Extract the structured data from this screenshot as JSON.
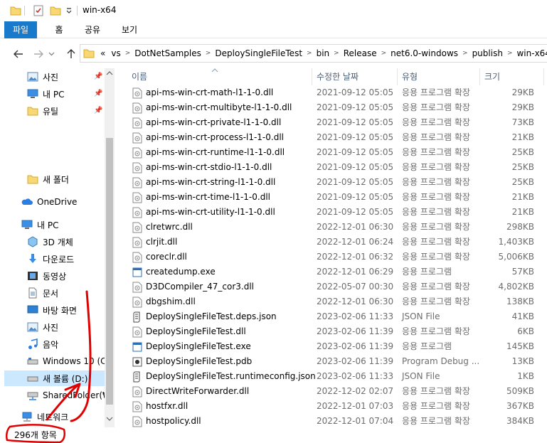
{
  "window": {
    "title": "win-x64",
    "colors": {
      "accent": "#1979ca",
      "selection": "#cce8ff",
      "annotation": "#e00000"
    }
  },
  "ribbon": {
    "tabs": [
      "파일",
      "홈",
      "공유",
      "보기"
    ]
  },
  "address": {
    "overflow": "«",
    "crumbs": [
      "vs",
      "DotNetSamples",
      "DeploySingleFileTest",
      "bin",
      "Release",
      "net6.0-windows",
      "publish",
      "win-x64"
    ]
  },
  "nav": {
    "quick": [
      {
        "label": "사진",
        "icon": "pictures-icon",
        "pinned": true
      },
      {
        "label": "내 PC",
        "icon": "pc-icon",
        "pinned": true
      },
      {
        "label": "유틸",
        "icon": "folder-icon",
        "pinned": true
      }
    ],
    "new_folder": "새 폴더",
    "onedrive": "OneDrive",
    "this_pc": "내 PC",
    "pc_items": [
      {
        "label": "3D 개체",
        "icon": "3d-objects-icon"
      },
      {
        "label": "다운로드",
        "icon": "download-icon"
      },
      {
        "label": "동영상",
        "icon": "video-icon"
      },
      {
        "label": "문서",
        "icon": "document-icon"
      },
      {
        "label": "바탕 화면",
        "icon": "desktop-icon"
      },
      {
        "label": "사진",
        "icon": "pictures-icon"
      },
      {
        "label": "음악",
        "icon": "music-icon"
      },
      {
        "label": "Windows 10 (C:",
        "icon": "drive-c-icon"
      },
      {
        "label": "새 볼륨 (D:)",
        "icon": "drive-d-icon",
        "selected": true
      },
      {
        "label": "SharedFolder(₩",
        "icon": "network-drive-icon"
      }
    ],
    "network": "네트워크"
  },
  "columns": {
    "name": "이름",
    "date": "수정한 날짜",
    "type": "유형",
    "size": "크기"
  },
  "files": [
    {
      "name": "api-ms-win-crt-math-l1-1-0.dll",
      "date": "2021-09-12 05:05",
      "type": "응용 프로그램 확장",
      "size": "29KB",
      "icon": "dll-icon"
    },
    {
      "name": "api-ms-win-crt-multibyte-l1-1-0.dll",
      "date": "2021-09-12 05:05",
      "type": "응용 프로그램 확장",
      "size": "29KB",
      "icon": "dll-icon"
    },
    {
      "name": "api-ms-win-crt-private-l1-1-0.dll",
      "date": "2021-09-12 05:05",
      "type": "응용 프로그램 확장",
      "size": "73KB",
      "icon": "dll-icon"
    },
    {
      "name": "api-ms-win-crt-process-l1-1-0.dll",
      "date": "2021-09-12 05:05",
      "type": "응용 프로그램 확장",
      "size": "21KB",
      "icon": "dll-icon"
    },
    {
      "name": "api-ms-win-crt-runtime-l1-1-0.dll",
      "date": "2021-09-12 05:05",
      "type": "응용 프로그램 확장",
      "size": "25KB",
      "icon": "dll-icon"
    },
    {
      "name": "api-ms-win-crt-stdio-l1-1-0.dll",
      "date": "2021-09-12 05:05",
      "type": "응용 프로그램 확장",
      "size": "25KB",
      "icon": "dll-icon"
    },
    {
      "name": "api-ms-win-crt-string-l1-1-0.dll",
      "date": "2021-09-12 05:05",
      "type": "응용 프로그램 확장",
      "size": "25KB",
      "icon": "dll-icon"
    },
    {
      "name": "api-ms-win-crt-time-l1-1-0.dll",
      "date": "2021-09-12 05:05",
      "type": "응용 프로그램 확장",
      "size": "21KB",
      "icon": "dll-icon"
    },
    {
      "name": "api-ms-win-crt-utility-l1-1-0.dll",
      "date": "2021-09-12 05:05",
      "type": "응용 프로그램 확장",
      "size": "21KB",
      "icon": "dll-icon"
    },
    {
      "name": "clretwrc.dll",
      "date": "2022-12-01 06:30",
      "type": "응용 프로그램 확장",
      "size": "298KB",
      "icon": "dll-icon"
    },
    {
      "name": "clrjit.dll",
      "date": "2022-12-01 06:24",
      "type": "응용 프로그램 확장",
      "size": "1,403KB",
      "icon": "dll-icon"
    },
    {
      "name": "coreclr.dll",
      "date": "2022-12-01 06:32",
      "type": "응용 프로그램 확장",
      "size": "5,006KB",
      "icon": "dll-icon"
    },
    {
      "name": "createdump.exe",
      "date": "2022-12-01 06:29",
      "type": "응용 프로그램",
      "size": "57KB",
      "icon": "exe-icon"
    },
    {
      "name": "D3DCompiler_47_cor3.dll",
      "date": "2022-05-07 00:30",
      "type": "응용 프로그램 확장",
      "size": "4,802KB",
      "icon": "dll-icon"
    },
    {
      "name": "dbgshim.dll",
      "date": "2022-12-01 06:30",
      "type": "응용 프로그램 확장",
      "size": "138KB",
      "icon": "dll-icon"
    },
    {
      "name": "DeploySingleFileTest.deps.json",
      "date": "2023-02-06 11:33",
      "type": "JSON File",
      "size": "41KB",
      "icon": "json-icon"
    },
    {
      "name": "DeploySingleFileTest.dll",
      "date": "2023-02-06 11:39",
      "type": "응용 프로그램 확장",
      "size": "6KB",
      "icon": "dll-icon"
    },
    {
      "name": "DeploySingleFileTest.exe",
      "date": "2023-02-06 11:39",
      "type": "응용 프로그램",
      "size": "145KB",
      "icon": "exe-icon"
    },
    {
      "name": "DeploySingleFileTest.pdb",
      "date": "2023-02-06 11:39",
      "type": "Program Debug ...",
      "size": "13KB",
      "icon": "pdb-icon"
    },
    {
      "name": "DeploySingleFileTest.runtimeconfig.json",
      "date": "2023-02-06 11:33",
      "type": "JSON File",
      "size": "1KB",
      "icon": "json-icon"
    },
    {
      "name": "DirectWriteForwarder.dll",
      "date": "2022-12-02 02:07",
      "type": "응용 프로그램 확장",
      "size": "509KB",
      "icon": "dll-icon"
    },
    {
      "name": "hostfxr.dll",
      "date": "2022-12-01 07:03",
      "type": "응용 프로그램 확장",
      "size": "367KB",
      "icon": "dll-icon"
    },
    {
      "name": "hostpolicy.dll",
      "date": "2022-12-01 07:04",
      "type": "응용 프로그램 확장",
      "size": "384KB",
      "icon": "dll-icon"
    }
  ],
  "status": {
    "item_count": "296개 항목"
  }
}
